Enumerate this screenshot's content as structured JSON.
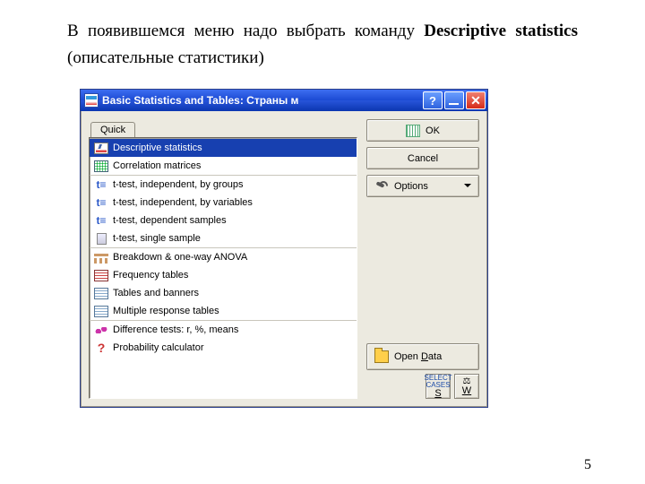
{
  "caption": {
    "prefix": "В появившемся меню надо выбрать команду ",
    "bold": "Descriptive statistics",
    "suffix": " (описательные статистики)"
  },
  "page_number": "5",
  "dialog": {
    "title": "Basic Statistics and Tables: Страны м",
    "titlebar": {
      "help": "?",
      "close": "✕"
    },
    "tab": "Quick",
    "groups": [
      [
        {
          "icon": "chart-icon",
          "label": "Descriptive statistics",
          "selected": true
        },
        {
          "icon": "grid-green-icon",
          "label": "Correlation matrices"
        }
      ],
      [
        {
          "icon": "ttest-icon",
          "label": "t-test, independent, by groups"
        },
        {
          "icon": "ttest-icon",
          "label": "t-test, independent, by variables"
        },
        {
          "icon": "ttest-icon",
          "label": "t-test, dependent samples"
        },
        {
          "icon": "single-col-icon",
          "label": "t-test, single sample"
        }
      ],
      [
        {
          "icon": "tree-icon",
          "label": "Breakdown & one-way ANOVA"
        },
        {
          "icon": "grid-red-icon",
          "label": "Frequency tables"
        },
        {
          "icon": "grid-lt-icon",
          "label": "Tables and banners"
        },
        {
          "icon": "grid-lt-icon",
          "label": "Multiple response tables"
        }
      ],
      [
        {
          "icon": "wave-icon",
          "label": "Difference tests: r, %, means"
        },
        {
          "icon": "qmark-icon",
          "label": "Probability calculator"
        }
      ]
    ],
    "buttons": {
      "ok": "OK",
      "cancel": "Cancel",
      "options": "Options",
      "open_data_pre": "Open ",
      "open_data_u": "D",
      "open_data_post": "ata"
    },
    "footer": {
      "select_cases": "SELECT CASES",
      "s": "S",
      "w": "W"
    }
  }
}
